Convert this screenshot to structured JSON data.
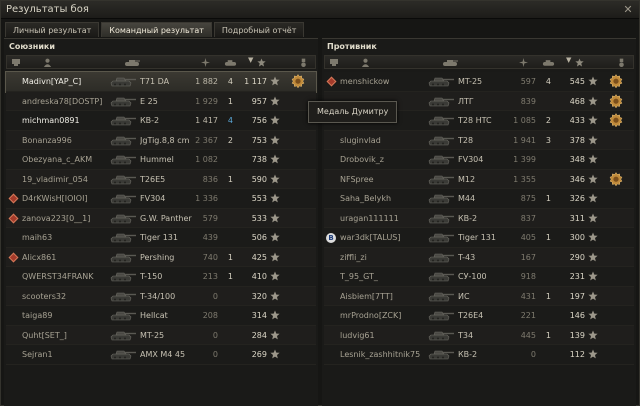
{
  "window": {
    "title": "Результаты боя",
    "close_icon": "close-icon"
  },
  "tabs": [
    {
      "label": "Личный результат",
      "active": false
    },
    {
      "label": "Командный результат",
      "active": true
    },
    {
      "label": "Подробный отчёт",
      "active": false
    }
  ],
  "allies": {
    "title": "Союзники",
    "players": [
      {
        "name": "Madivn[YAP_C]",
        "tank": "T71 DA",
        "damage": "1 882",
        "kills": "4",
        "xp": "1 117",
        "medal": true,
        "highlight": true,
        "style": "self"
      },
      {
        "name": "andreska78[DOSTP]",
        "tank": "E 25",
        "damage": "1 929",
        "kills": "1",
        "xp": "957",
        "style": "dim",
        "dmg_dim": true
      },
      {
        "name": "michman0891",
        "tank": "КВ-2",
        "damage": "1 417",
        "kills": "4",
        "kills_blue": true,
        "xp": "756",
        "style": "self"
      },
      {
        "name": "Bonanza996",
        "tank": "JgTig.8,8 cm",
        "damage": "2 367",
        "kills": "2",
        "xp": "753",
        "style": "dim",
        "dmg_dim": true
      },
      {
        "name": "Obezyana_c_AKM",
        "tank": "Hummel",
        "damage": "1 082",
        "kills": "",
        "xp": "738",
        "style": "dim",
        "dmg_dim": true
      },
      {
        "name": "19_vladimir_054",
        "tank": "T26E5",
        "damage": "836",
        "kills": "1",
        "xp": "590",
        "style": "dim",
        "dmg_dim": true
      },
      {
        "name": "D4rKWisH[IOIOI]",
        "tank": "FV304",
        "damage": "1 336",
        "kills": "",
        "xp": "553",
        "rank": true,
        "style": "dim",
        "dmg_dim": true
      },
      {
        "name": "zanova223[0__1]",
        "tank": "G.W. Panther",
        "damage": "579",
        "kills": "",
        "xp": "533",
        "rank": true,
        "style": "dim",
        "dmg_dim": true
      },
      {
        "name": "maih63",
        "tank": "Tiger 131",
        "damage": "439",
        "kills": "",
        "xp": "506",
        "style": "dim",
        "dmg_dim": true
      },
      {
        "name": "Alicx861",
        "tank": "Pershing",
        "damage": "740",
        "kills": "1",
        "xp": "425",
        "rank": true,
        "style": "dim",
        "dmg_dim": true
      },
      {
        "name": "QWERST34FRANK",
        "tank": "T-150",
        "damage": "213",
        "kills": "1",
        "xp": "410",
        "style": "dim",
        "dmg_dim": true
      },
      {
        "name": "scooters32",
        "tank": "T-34/100",
        "damage": "0",
        "kills": "",
        "xp": "320",
        "style": "dim",
        "dmg_dim": true
      },
      {
        "name": "taiga89",
        "tank": "Hellcat",
        "damage": "208",
        "kills": "",
        "xp": "314",
        "style": "dim",
        "dmg_dim": true
      },
      {
        "name": "Quht[SET_]",
        "tank": "MT-25",
        "damage": "0",
        "kills": "",
        "xp": "284",
        "style": "dim",
        "dmg_dim": true
      },
      {
        "name": "Sejran1",
        "tank": "AMX M4 45",
        "damage": "0",
        "kills": "",
        "xp": "269",
        "style": "dim",
        "dmg_dim": true
      }
    ]
  },
  "enemies": {
    "title": "Противник",
    "players": [
      {
        "name": "menshickow",
        "tank": "MT-25",
        "damage": "597",
        "kills": "4",
        "xp": "545",
        "rank": true,
        "medal": true,
        "style": "dim",
        "dmg_dim": true
      },
      {
        "name": "",
        "tank": "ЛТГ",
        "damage": "839",
        "kills": "",
        "xp": "468",
        "medal": true,
        "style": "dim",
        "dmg_dim": true
      },
      {
        "name": "faleton",
        "tank": "T28 HTC",
        "damage": "1 085",
        "kills": "2",
        "xp": "433",
        "medal": true,
        "style": "dim",
        "dmg_dim": true
      },
      {
        "name": "sluginvlad",
        "tank": "T28",
        "damage": "1 941",
        "kills": "3",
        "xp": "378",
        "style": "dim",
        "dmg_dim": true
      },
      {
        "name": "Drobovik_z",
        "tank": "FV304",
        "damage": "1 399",
        "kills": "",
        "xp": "348",
        "style": "dim",
        "dmg_dim": true
      },
      {
        "name": "NFSpree",
        "tank": "M12",
        "damage": "1 355",
        "kills": "",
        "xp": "346",
        "medal": true,
        "style": "dim",
        "dmg_dim": true
      },
      {
        "name": "Saha_Belykh",
        "tank": "M44",
        "damage": "875",
        "kills": "1",
        "xp": "326",
        "style": "dim",
        "dmg_dim": true
      },
      {
        "name": "uragan111111",
        "tank": "КВ-2",
        "damage": "837",
        "kills": "",
        "xp": "311",
        "style": "dim",
        "dmg_dim": true
      },
      {
        "name": "war3dk[TALUS]",
        "tank": "Tiger 131",
        "damage": "405",
        "kills": "1",
        "xp": "300",
        "clan": "B",
        "style": "dim",
        "dmg_dim": true
      },
      {
        "name": "ziffli_zi",
        "tank": "T-43",
        "damage": "167",
        "kills": "",
        "xp": "290",
        "style": "dim",
        "dmg_dim": true
      },
      {
        "name": "T_95_GT_",
        "tank": "СУ-100",
        "damage": "918",
        "kills": "",
        "xp": "231",
        "style": "dim",
        "dmg_dim": true
      },
      {
        "name": "Aisbiem[7TT]",
        "tank": "ИС",
        "damage": "431",
        "kills": "1",
        "xp": "197",
        "style": "dim",
        "dmg_dim": true
      },
      {
        "name": "mrProdno[ZCK]",
        "tank": "T26E4",
        "damage": "221",
        "kills": "",
        "xp": "146",
        "style": "dim",
        "dmg_dim": true
      },
      {
        "name": "ludvig61",
        "tank": "T34",
        "damage": "445",
        "kills": "1",
        "xp": "139",
        "style": "dim",
        "dmg_dim": true
      },
      {
        "name": "Lesnik_zashhitnik75",
        "tank": "КВ-2",
        "damage": "0",
        "kills": "",
        "xp": "112",
        "style": "dim",
        "dmg_dim": true
      }
    ]
  },
  "tooltip": {
    "text": "Медаль Думитру"
  },
  "colors": {
    "medal": "#c08a3a",
    "rank_icon": "#a43a2a",
    "kills_blue": "#5aa8d8"
  }
}
